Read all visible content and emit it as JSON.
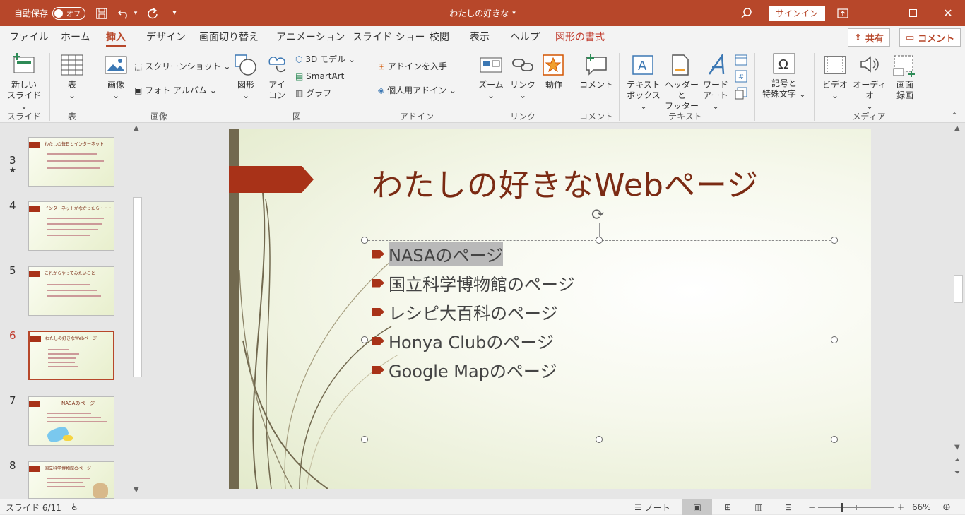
{
  "titlebar": {
    "autosave_label": "自動保存",
    "autosave_state": "オフ",
    "doc_title": "わたしの好きな",
    "signin_label": "サインイン"
  },
  "tabs": [
    "ファイル",
    "ホーム",
    "挿入",
    "デザイン",
    "画面切り替え",
    "アニメーション",
    "スライド ショー",
    "校閲",
    "表示",
    "ヘルプ",
    "図形の書式"
  ],
  "active_tab": "挿入",
  "share_label": "共有",
  "comment_label": "コメント",
  "ribbon": {
    "new_slide_1": "新しい",
    "new_slide_2": "スライド",
    "table": "表",
    "image": "画像",
    "screenshot": "スクリーンショット",
    "photo_album": "フォト アルバム",
    "shapes": "図形",
    "icons_1": "アイ",
    "icons_2": "コン",
    "model_3d": "3D モデル",
    "smartart": "SmartArt",
    "graph": "グラフ",
    "get_addins": "アドインを入手",
    "my_addins": "個人用アドイン",
    "zoom": "ズーム",
    "link": "リンク",
    "action": "動作",
    "comment": "コメント",
    "textbox_1": "テキスト",
    "textbox_2": "ボックス",
    "header_1": "ヘッダーと",
    "header_2": "フッター",
    "wordart_1": "ワード",
    "wordart_2": "アート",
    "symbols_1": "記号と",
    "symbols_2": "特殊文字",
    "video": "ビデオ",
    "audio": "オーディオ",
    "screen_rec_1": "画面",
    "screen_rec_2": "録画",
    "groups": {
      "slides": "スライド",
      "table": "表",
      "images": "画像",
      "illustrations": "図",
      "addins": "アドイン",
      "links": "リンク",
      "comments": "コメント",
      "text": "テキスト",
      "media": "メディア"
    }
  },
  "thumbnails": [
    {
      "num": "3",
      "title": "わたしの毎日とインターネット"
    },
    {
      "num": "4",
      "title": "インターネットがなかったら・・・"
    },
    {
      "num": "5",
      "title": "これからやってみたいこと"
    },
    {
      "num": "6",
      "title": "わたしの好きなWebページ"
    },
    {
      "num": "7",
      "title": "NASAのページ"
    },
    {
      "num": "8",
      "title": "国立科学博物館のページ"
    }
  ],
  "current_slide": "6",
  "slide": {
    "title": "わたしの好きなWebページ",
    "bullets": [
      "NASAのページ",
      "国立科学博物館のページ",
      "レシピ大百科のページ",
      "Honya Clubのページ",
      "Google Mapのページ"
    ]
  },
  "status": {
    "slide_info": "スライド 6/11",
    "notes": "ノート",
    "zoom": "66%"
  },
  "colors": {
    "accent": "#b7472a",
    "slide_title": "#7b2b14",
    "bullet": "#a83218"
  }
}
